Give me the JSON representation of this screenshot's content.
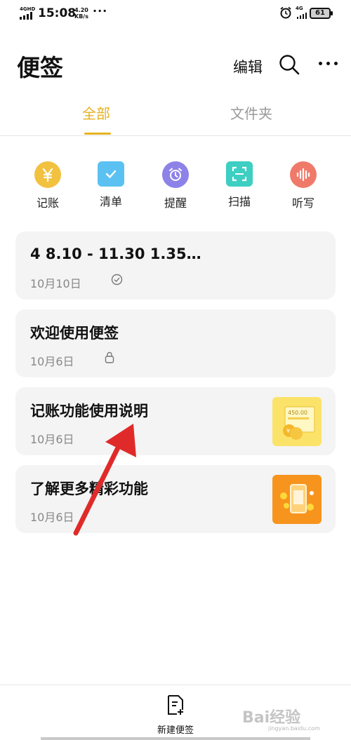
{
  "status_bar": {
    "network": "4GHD",
    "time": "15:08",
    "speed_value": "4.20",
    "speed_unit": "KB/s",
    "more": "···",
    "network2": "4G",
    "battery": "61"
  },
  "header": {
    "title": "便签",
    "edit_label": "编辑",
    "icons": [
      "search-icon",
      "more-icon"
    ]
  },
  "tabs": [
    {
      "label": "全部",
      "active": true
    },
    {
      "label": "文件夹",
      "active": false
    }
  ],
  "quick_actions": [
    {
      "label": "记账",
      "icon": "yen-icon",
      "color": "#f2c140"
    },
    {
      "label": "清单",
      "icon": "checklist-icon",
      "color": "#5bc1f2"
    },
    {
      "label": "提醒",
      "icon": "alarm-icon",
      "color": "#8d82e8"
    },
    {
      "label": "扫描",
      "icon": "scan-icon",
      "color": "#3ccfc2"
    },
    {
      "label": "听写",
      "icon": "voice-icon",
      "color": "#f07a6a"
    }
  ],
  "notes": [
    {
      "title": "4  8.10 - 11.30   1.35…",
      "date": "10月10日",
      "status_icon": "check-circle-icon"
    },
    {
      "title": "欢迎使用便签",
      "date": "10月6日",
      "status_icon": "lock-icon"
    },
    {
      "title": "记账功能使用说明",
      "date": "10月6日",
      "thumb": "bookkeeping-thumbnail",
      "thumb_text": "450.00"
    },
    {
      "title": "了解更多精彩功能",
      "date": "10月6日",
      "thumb": "features-thumbnail"
    }
  ],
  "bottom": {
    "new_note_label": "新建便签",
    "icon": "new-note-icon"
  },
  "overlay": {
    "watermark": "Bai经验",
    "watermark_sub": "jingyan.baidu.com",
    "accent": "#e02a2a"
  },
  "colors": {
    "accent": "#e6b21e",
    "card_bg": "#f4f4f4"
  }
}
